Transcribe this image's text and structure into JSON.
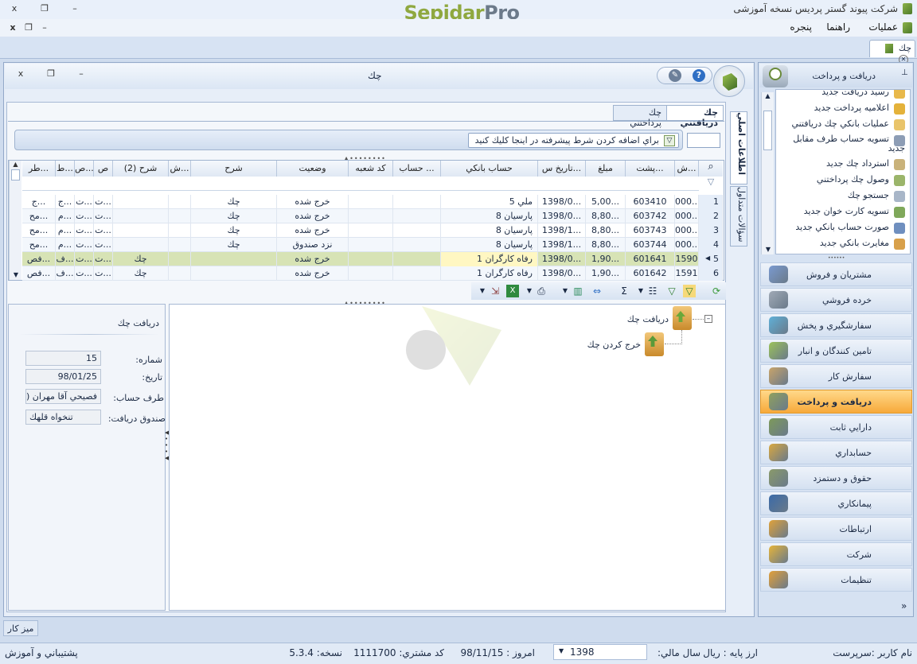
{
  "app": {
    "title": "شرکت پیوند گستر پردیس نسخه آموزشی",
    "logo_part1": "Sepidar",
    "logo_part2": "Pro",
    "close": "x",
    "restore": "❐",
    "minimize": "–"
  },
  "menu": {
    "operations": "عملیات",
    "guide": "راهنما",
    "window": "پنجره",
    "close": "x",
    "restore": "❐",
    "minimize": "–"
  },
  "doc_tab": {
    "label": "چك",
    "close": "✕"
  },
  "child": {
    "title": "چك",
    "close": "x",
    "restore": "❐",
    "minimize": "–",
    "help": "?"
  },
  "tabs": {
    "received": "چك دريافتني",
    "paid": "چك پرداختني"
  },
  "side_tabs": {
    "main_info": "اطلاعات اصلي",
    "frequent_questions": "سؤالات متداول"
  },
  "filter": {
    "add_condition": "براي اضافه كردن شرط پيشرفته در اينجا كليك كنيد"
  },
  "grid": {
    "columns": [
      "ش...",
      "پشت...",
      "مبلغ",
      "تاريخ س...",
      "حساب بانكي",
      "حساب ...",
      "كد شعبه",
      "وضعيت",
      "شرح",
      "ش...",
      "شرح (2)",
      "ص",
      "ص...",
      "ط...",
      "طر..."
    ],
    "rows": [
      {
        "idx": "1",
        "no": "000...",
        "back": "603410",
        "amount": "5,00...",
        "date": "1398/0...",
        "bank": "ملي  5",
        "acc": "",
        "branch": "",
        "status": "خرج شده",
        "desc": "چك",
        "s": "",
        "desc2": "",
        "c1": "ت...",
        "c2": "ت...",
        "c3": "ج...",
        "c4": "ج..."
      },
      {
        "idx": "2",
        "no": "000...",
        "back": "603742",
        "amount": "8,80...",
        "date": "1398/0...",
        "bank": "پارسيان  8",
        "acc": "",
        "branch": "",
        "status": "خرج شده",
        "desc": "چك",
        "s": "",
        "desc2": "",
        "c1": "ت...",
        "c2": "ت...",
        "c3": "م...",
        "c4": "مح..."
      },
      {
        "idx": "3",
        "no": "000...",
        "back": "603743",
        "amount": "8,80...",
        "date": "1398/1...",
        "bank": "پارسيان  8",
        "acc": "",
        "branch": "",
        "status": "خرج شده",
        "desc": "چك",
        "s": "",
        "desc2": "",
        "c1": "ت...",
        "c2": "ت...",
        "c3": "م...",
        "c4": "مح..."
      },
      {
        "idx": "4",
        "no": "000...",
        "back": "603744",
        "amount": "8,80...",
        "date": "1398/1...",
        "bank": "پارسيان  8",
        "acc": "",
        "branch": "",
        "status": "نزد صندوق",
        "desc": "چك",
        "s": "",
        "desc2": "",
        "c1": "ت...",
        "c2": "ت...",
        "c3": "م...",
        "c4": "مح..."
      },
      {
        "idx": "5",
        "no": "1590",
        "back": "601641",
        "amount": "1,90...",
        "date": "1398/0...",
        "bank": "رفاه كارگران  1",
        "acc": "",
        "branch": "",
        "status": "خرج شده",
        "desc": "",
        "s": "",
        "desc2": "چك",
        "c1": "ت...",
        "c2": "ت...",
        "c3": "ف...",
        "c4": "فص..."
      },
      {
        "idx": "6",
        "no": "1591",
        "back": "601642",
        "amount": "1,90...",
        "date": "1398/0...",
        "bank": "رفاه كارگران  1",
        "acc": "",
        "branch": "",
        "status": "خرج شده",
        "desc": "",
        "s": "",
        "desc2": "چك",
        "c1": "ت...",
        "c2": "ت...",
        "c3": "ف...",
        "c4": "فص..."
      }
    ]
  },
  "detail": {
    "title": "دريافت چك",
    "number_label": "شماره:",
    "number_value": "15",
    "date_label": "تاريخ:",
    "date_value": "98/01/25",
    "party_label": "طرف حساب:",
    "party_value": "فصيحي آقا مهران (",
    "box_label": "صندوق دريافت:",
    "box_value": "تنخواه قلهك"
  },
  "flow": {
    "node1": "دريافت چك",
    "node2": "خرج كردن چك",
    "collapse": "–"
  },
  "nav": {
    "header": "دريافت و پرداخت",
    "pin": "⊥",
    "items": [
      {
        "label": "رسيد دريافت جديد",
        "color": "#e8b84a"
      },
      {
        "label": "اعلاميه پرداخت جديد",
        "color": "#e4b23a"
      },
      {
        "label": "عمليات بانكي چك دريافتني",
        "color": "#e9c46a"
      },
      {
        "label": "تسويه حساب طرف مقابل جديد",
        "color": "#8d9db5"
      },
      {
        "label": "استرداد چك جديد",
        "color": "#c9b27a"
      },
      {
        "label": "وصول چك پرداختني",
        "color": "#9bb56a"
      },
      {
        "label": "جستجو چك",
        "color": "#a8b6c8"
      },
      {
        "label": "تسويه كارت خوان جديد",
        "color": "#7fa85a"
      },
      {
        "label": "صورت حساب بانكي جديد",
        "color": "#6f8fbf"
      },
      {
        "label": "مغايرت بانكي جديد",
        "color": "#d8a04a"
      }
    ],
    "modules": [
      {
        "label": "مشتريان و فروش",
        "color": "#7a9ad0",
        "active": false
      },
      {
        "label": "خرده فروشي",
        "color": "#a0a9b6",
        "active": false
      },
      {
        "label": "سفارشگيري و پخش",
        "color": "#5fb0d8",
        "active": false
      },
      {
        "label": "تامين كنندگان و انبار",
        "color": "#9bc25a",
        "active": false
      },
      {
        "label": "سفارش كار",
        "color": "#c9a46a",
        "active": false
      },
      {
        "label": "دريافت و پرداخت",
        "color": "#8fa05e",
        "active": true
      },
      {
        "label": "دارايي ثابت",
        "color": "#7d9a5a",
        "active": false
      },
      {
        "label": "حسابداري",
        "color": "#d9a840",
        "active": false
      },
      {
        "label": "حقوق و دستمزد",
        "color": "#8a9a6a",
        "active": false
      },
      {
        "label": "پيمانكاري",
        "color": "#3a6aa8",
        "active": false
      },
      {
        "label": "ارتباطات",
        "color": "#e0a23a",
        "active": false
      },
      {
        "label": "شركت",
        "color": "#e6b43a",
        "active": false
      },
      {
        "label": "تنظيمات",
        "color": "#e3a03a",
        "active": false
      }
    ],
    "expand": "»"
  },
  "bottom": {
    "desk": "ميز كار"
  },
  "status": {
    "user": "نام كاربر :سرپرست",
    "currency": "ارز پايه :   ريال",
    "fiscal_label": "سال مالي:",
    "fiscal_value": "1398",
    "today": "امروز :   98/11/15",
    "customer": "كد مشتري:   1111700",
    "version": "نسخه:   5.3.4",
    "support": "پشتيباني و آموزش"
  }
}
